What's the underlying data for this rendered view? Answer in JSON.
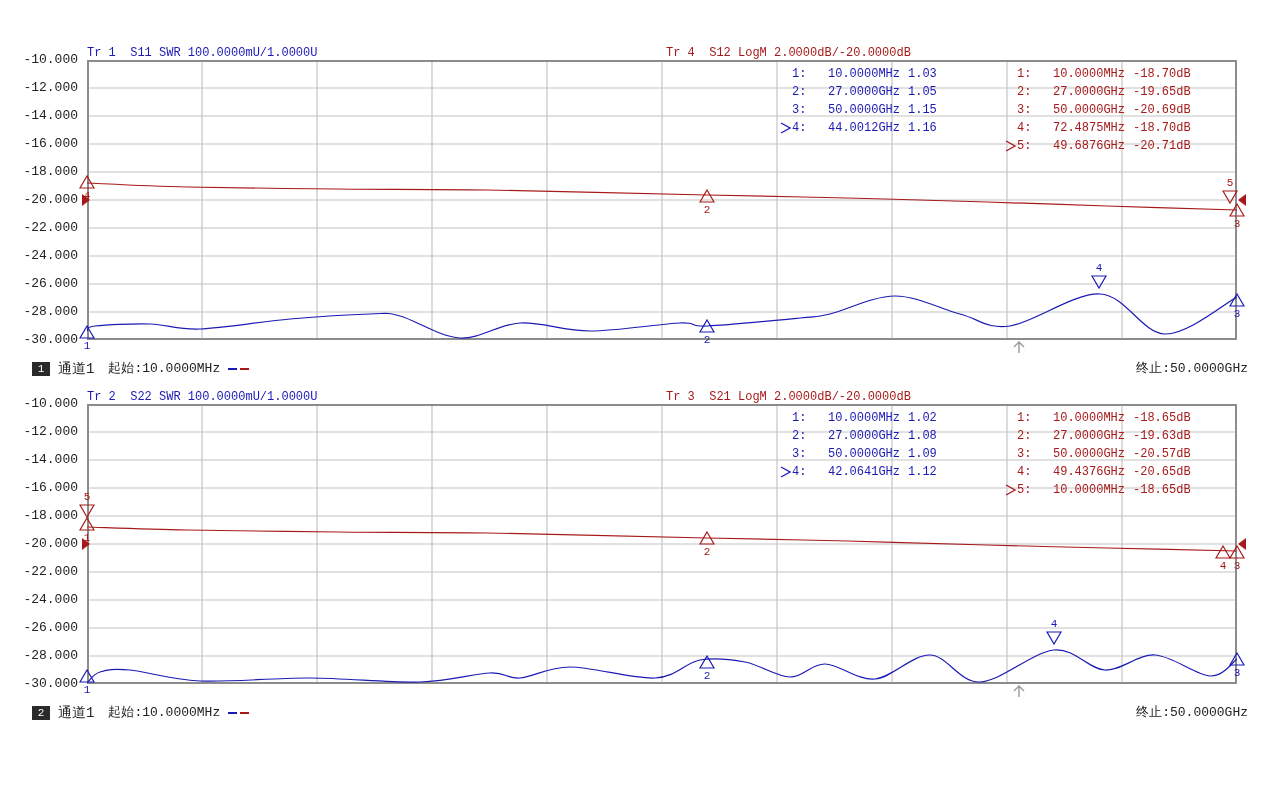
{
  "panels": [
    {
      "channel_number": "1",
      "channel_label": "通道1",
      "start": "起始:10.0000MHz",
      "stop": "终止:50.0000GHz",
      "y_labels": [
        "-10.000",
        "-12.000",
        "-14.000",
        "-16.000",
        "-18.000",
        "-20.000",
        "-22.000",
        "-24.000",
        "-26.000",
        "-28.000",
        "-30.000"
      ],
      "traces": [
        {
          "title": "Tr 1  S11 SWR 100.0000mU/1.0000U",
          "color": "#1a1ab4",
          "reference_arrow": false,
          "markers": [
            {
              "label": "1",
              "selected": false
            },
            {
              "label": "2",
              "selected": false
            },
            {
              "label": "3",
              "selected": false
            },
            {
              "label": "4",
              "selected": true
            }
          ],
          "readouts": [
            {
              "index": "1:",
              "frequency": "10.0000MHz",
              "value": "1.03",
              "selected": false
            },
            {
              "index": "2:",
              "frequency": "27.0000GHz",
              "value": "1.05",
              "selected": false
            },
            {
              "index": "3:",
              "frequency": "50.0000GHz",
              "value": "1.15",
              "selected": false
            },
            {
              "index": "4:",
              "frequency": "44.0012GHz",
              "value": "1.16",
              "selected": true
            }
          ]
        },
        {
          "title": "Tr 4  S12 LogM 2.0000dB/-20.0000dB",
          "color": "#a81a1a",
          "reference_arrow": true,
          "markers": [
            {
              "label": "4",
              "selected": false
            },
            {
              "label": "2",
              "selected": false
            },
            {
              "label": "3",
              "selected": false
            },
            {
              "label": "5",
              "selected": true
            }
          ],
          "readouts": [
            {
              "index": "1:",
              "frequency": "10.0000MHz",
              "value": "-18.70dB",
              "selected": false
            },
            {
              "index": "2:",
              "frequency": "27.0000GHz",
              "value": "-19.65dB",
              "selected": false
            },
            {
              "index": "3:",
              "frequency": "50.0000GHz",
              "value": "-20.69dB",
              "selected": false
            },
            {
              "index": "4:",
              "frequency": "72.4875MHz",
              "value": "-18.70dB",
              "selected": false
            },
            {
              "index": "5:",
              "frequency": "49.6876GHz",
              "value": "-20.71dB",
              "selected": true
            }
          ]
        }
      ]
    },
    {
      "channel_number": "2",
      "channel_label": "通道1",
      "start": "起始:10.0000MHz",
      "stop": "终止:50.0000GHz",
      "y_labels": [
        "-10.000",
        "-12.000",
        "-14.000",
        "-16.000",
        "-18.000",
        "-20.000",
        "-22.000",
        "-24.000",
        "-26.000",
        "-28.000",
        "-30.000"
      ],
      "traces": [
        {
          "title": "Tr 2  S22 SWR 100.0000mU/1.0000U",
          "color": "#1a1ab4",
          "reference_arrow": false,
          "markers": [
            {
              "label": "1",
              "selected": false
            },
            {
              "label": "2",
              "selected": false
            },
            {
              "label": "3",
              "selected": false
            },
            {
              "label": "4",
              "selected": true
            }
          ],
          "readouts": [
            {
              "index": "1:",
              "frequency": "10.0000MHz",
              "value": "1.02",
              "selected": false
            },
            {
              "index": "2:",
              "frequency": "27.0000GHz",
              "value": "1.08",
              "selected": false
            },
            {
              "index": "3:",
              "frequency": "50.0000GHz",
              "value": "1.09",
              "selected": false
            },
            {
              "index": "4:",
              "frequency": "42.0641GHz",
              "value": "1.12",
              "selected": true
            }
          ]
        },
        {
          "title": "Tr 3  S21 LogM 2.0000dB/-20.0000dB",
          "color": "#a81a1a",
          "reference_arrow": true,
          "markers": [
            {
              "label": "1",
              "selected": false
            },
            {
              "label": "2",
              "selected": false
            },
            {
              "label": "3",
              "selected": false
            },
            {
              "label": "4",
              "selected": false
            },
            {
              "label": "5",
              "selected": true
            }
          ],
          "readouts": [
            {
              "index": "1:",
              "frequency": "10.0000MHz",
              "value": "-18.65dB",
              "selected": false
            },
            {
              "index": "2:",
              "frequency": "27.0000GHz",
              "value": "-19.63dB",
              "selected": false
            },
            {
              "index": "3:",
              "frequency": "50.0000GHz",
              "value": "-20.57dB",
              "selected": false
            },
            {
              "index": "4:",
              "frequency": "49.4376GHz",
              "value": "-20.65dB",
              "selected": false
            },
            {
              "index": "5:",
              "frequency": "10.0000MHz",
              "value": "-18.65dB",
              "selected": true
            }
          ]
        }
      ]
    }
  ]
}
